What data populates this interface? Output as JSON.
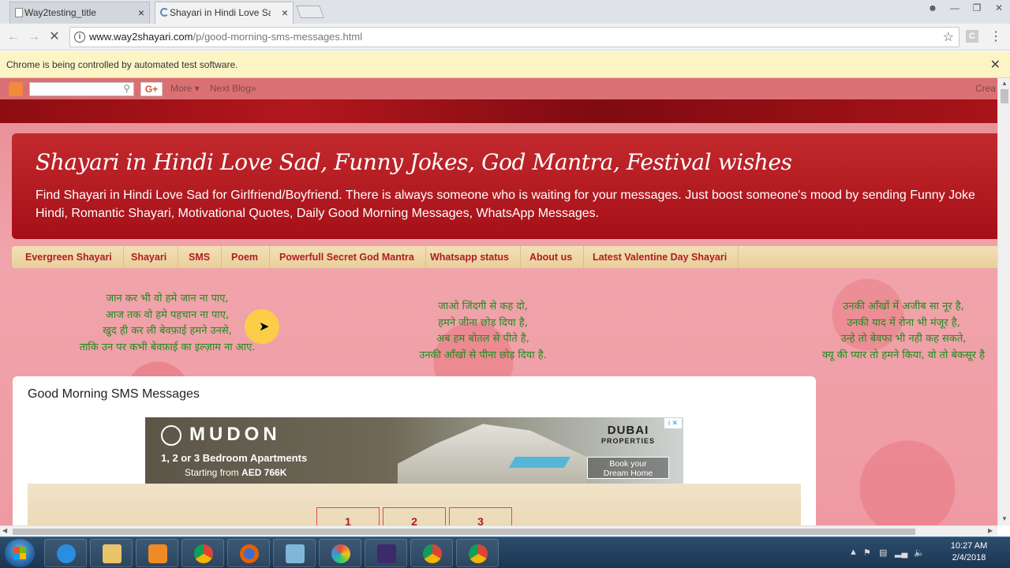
{
  "browser": {
    "tabs": [
      {
        "label": "Way2testing_title",
        "active": false
      },
      {
        "label": "Shayari in Hindi Love Sad",
        "active": true
      }
    ],
    "address": {
      "host": "www.way2shayari.com",
      "path": "/p/good-morning-sms-messages.html"
    },
    "infobar_message": "Chrome is being controlled by automated test software."
  },
  "blogger_bar": {
    "more": "More ▾",
    "next_blog": "Next Blog»",
    "create": "Crea"
  },
  "header": {
    "title": "Shayari in Hindi Love Sad, Funny Jokes, God Mantra, Festival wishes",
    "description_line1": "Find Shayari in Hindi Love Sad for Girlfriend/Boyfriend. There is always someone who is waiting for your messages. Just boost someone's mood by sending Funny Joke",
    "description_line2": "Hindi, Romantic Shayari, Motivational Quotes, Daily Good Morning Messages, WhatsApp Messages."
  },
  "nav": {
    "items": [
      "Evergreen Shayari",
      "Shayari",
      "SMS",
      "Poem",
      "Powerfull Secret God Mantra",
      "Whatsapp status",
      "About us",
      "Latest Valentine Day Shayari"
    ]
  },
  "poems": [
    {
      "lines": [
        "जान कर भी वो हमे जान ना पाए,",
        "आज तक वो हमे पहचान ना पाए,",
        "खुद ही कर ली बेवफ़ाई हमने उनसे,",
        "ताकि उन पर कभी बेवफ़ाई का इल्ज़ाम ना आए."
      ]
    },
    {
      "lines": [
        "जाओ जिंदगी से कह दो,",
        "हमने जीना छोड़ दिया है,",
        "अब हम बोतल से पीते है,",
        "उनकी आँखों से पीना छोड़ दिया है."
      ]
    },
    {
      "lines": [
        "उनकी आँखों में अजीब सा नूर है,",
        "उनकी याद में रोना भी मंजूर है,",
        "उन्हे तो बेवफा भी नही कह सकते,",
        "क्यू की प्यार तो हमने किया, वो तो बेकसूर है"
      ]
    }
  ],
  "post": {
    "title": "Good Morning SMS Messages",
    "ad": {
      "brand": "MUDON",
      "line1": "1, 2 or 3 Bedroom Apartments",
      "line2_prefix": "Starting from ",
      "line2_price": "AED 766K",
      "partner": "DUBAI",
      "partner_sub": "PROPERTIES",
      "cta_line1": "Book your",
      "cta_line2": "Dream Home"
    },
    "pagination": [
      "1",
      "2",
      "3"
    ]
  },
  "taskbar": {
    "time": "10:27 AM",
    "date": "2/4/2018"
  },
  "colors": {
    "header_red": "#b5161d",
    "nav_text": "#b01e1e",
    "poem_green": "#1f8a1f",
    "infobar_bg": "#fdf4c5"
  }
}
